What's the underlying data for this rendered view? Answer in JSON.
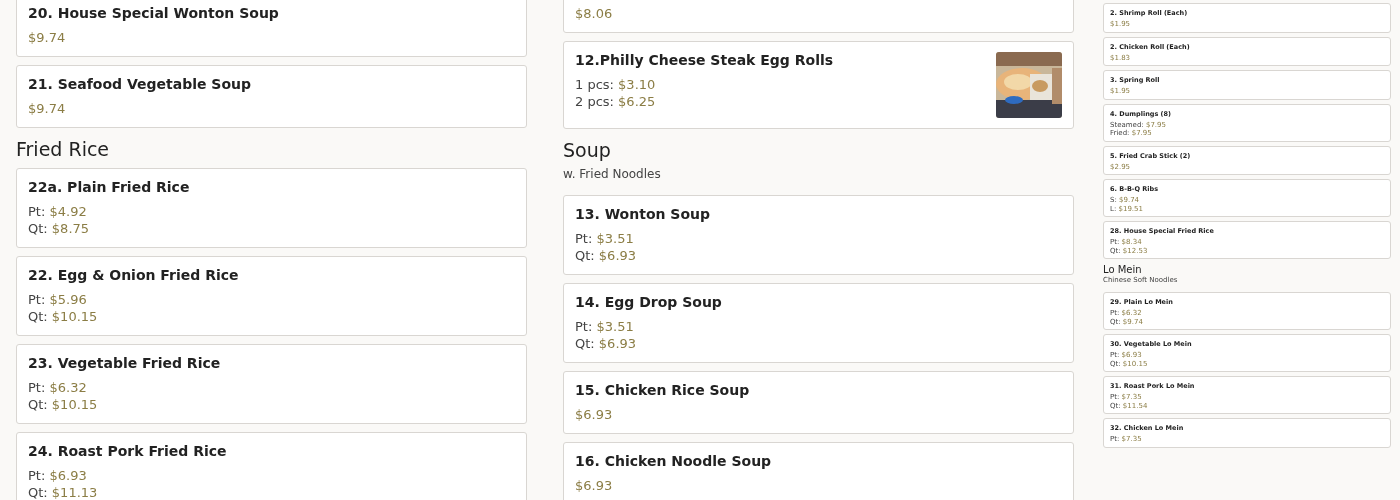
{
  "columns": [
    {
      "sections": [
        {
          "items": [
            {
              "name": "20. House Special Wonton Soup",
              "prices": [
                {
                  "value": "$9.74"
                }
              ]
            },
            {
              "name": "21. Seafood Vegetable Soup",
              "prices": [
                {
                  "value": "$9.74"
                }
              ]
            }
          ]
        },
        {
          "heading": "Fried Rice",
          "items": [
            {
              "name": "22a. Plain Fried Rice",
              "prices": [
                {
                  "label": "Pt:",
                  "value": "$4.92"
                },
                {
                  "label": "Qt:",
                  "value": "$8.75"
                }
              ]
            },
            {
              "name": "22. Egg & Onion Fried Rice",
              "prices": [
                {
                  "label": "Pt:",
                  "value": "$5.96"
                },
                {
                  "label": "Qt:",
                  "value": "$10.15"
                }
              ]
            },
            {
              "name": "23. Vegetable Fried Rice",
              "prices": [
                {
                  "label": "Pt:",
                  "value": "$6.32"
                },
                {
                  "label": "Qt:",
                  "value": "$10.15"
                }
              ]
            },
            {
              "name": "24. Roast Pork Fried Rice",
              "prices": [
                {
                  "label": "Pt:",
                  "value": "$6.93"
                },
                {
                  "label": "Qt:",
                  "value": "$11.13"
                }
              ]
            }
          ]
        }
      ]
    },
    {
      "sections": [
        {
          "items": [
            {
              "prices": [
                {
                  "value": "$8.06"
                }
              ]
            },
            {
              "name": "12.Philly Cheese Steak Egg Rolls",
              "prices": [
                {
                  "label": "1 pcs:",
                  "value": "$3.10"
                },
                {
                  "label": "2 pcs:",
                  "value": "$6.25"
                }
              ],
              "image": {
                "kind": "picture"
              }
            }
          ]
        },
        {
          "heading": "Soup",
          "subheading": "w. Fried Noodles",
          "items": [
            {
              "name": "13. Wonton Soup",
              "prices": [
                {
                  "label": "Pt:",
                  "value": "$3.51"
                },
                {
                  "label": "Qt:",
                  "value": "$6.93"
                }
              ]
            },
            {
              "name": "14. Egg Drop Soup",
              "prices": [
                {
                  "label": "Pt:",
                  "value": "$3.51"
                },
                {
                  "label": "Qt:",
                  "value": "$6.93"
                }
              ]
            },
            {
              "name": "15. Chicken Rice Soup",
              "prices": [
                {
                  "value": "$6.93"
                }
              ]
            },
            {
              "name": "16. Chicken Noodle Soup",
              "prices": [
                {
                  "value": "$6.93"
                }
              ]
            }
          ]
        }
      ]
    },
    {
      "sections": [
        {
          "items": [
            {
              "name": "2. Shrimp Roll (Each)",
              "prices": [
                {
                  "value": "$1.95"
                }
              ]
            },
            {
              "name": "2. Chicken Roll (Each)",
              "prices": [
                {
                  "value": "$1.83"
                }
              ]
            },
            {
              "name": "3. Spring Roll",
              "prices": [
                {
                  "value": "$1.95"
                }
              ]
            },
            {
              "name": "4. Dumplings (8)",
              "prices": [
                {
                  "label": "Steamed:",
                  "value": "$7.95"
                },
                {
                  "label": "Fried:",
                  "value": "$7.95"
                }
              ]
            },
            {
              "name": "5. Fried Crab Stick (2)",
              "prices": [
                {
                  "value": "$2.95"
                }
              ]
            },
            {
              "name": "6. B-B-Q Ribs",
              "prices": [
                {
                  "label": "S:",
                  "value": "$9.74"
                },
                {
                  "label": "L:",
                  "value": "$19.51"
                }
              ]
            },
            {
              "name": "28. House Special Fried Rice",
              "prices": [
                {
                  "label": "Pt:",
                  "value": "$8.34"
                },
                {
                  "label": "Qt:",
                  "value": "$12.53"
                }
              ]
            }
          ]
        },
        {
          "heading": "Lo Mein",
          "subheading": "Chinese Soft Noodles",
          "items": [
            {
              "name": "29. Plain Lo Mein",
              "prices": [
                {
                  "label": "Pt:",
                  "value": "$6.32"
                },
                {
                  "label": "Qt:",
                  "value": "$9.74"
                }
              ]
            },
            {
              "name": "30. Vegetable Lo Mein",
              "prices": [
                {
                  "label": "Pt:",
                  "value": "$6.93"
                },
                {
                  "label": "Qt:",
                  "value": "$10.15"
                }
              ]
            },
            {
              "name": "31. Roast Pork Lo Mein",
              "prices": [
                {
                  "label": "Pt:",
                  "value": "$7.35"
                },
                {
                  "label": "Qt:",
                  "value": "$11.54"
                }
              ]
            },
            {
              "name": "32. Chicken Lo Mein",
              "prices": [
                {
                  "label": "Pt:",
                  "value": "$7.35"
                }
              ]
            }
          ]
        }
      ]
    }
  ]
}
